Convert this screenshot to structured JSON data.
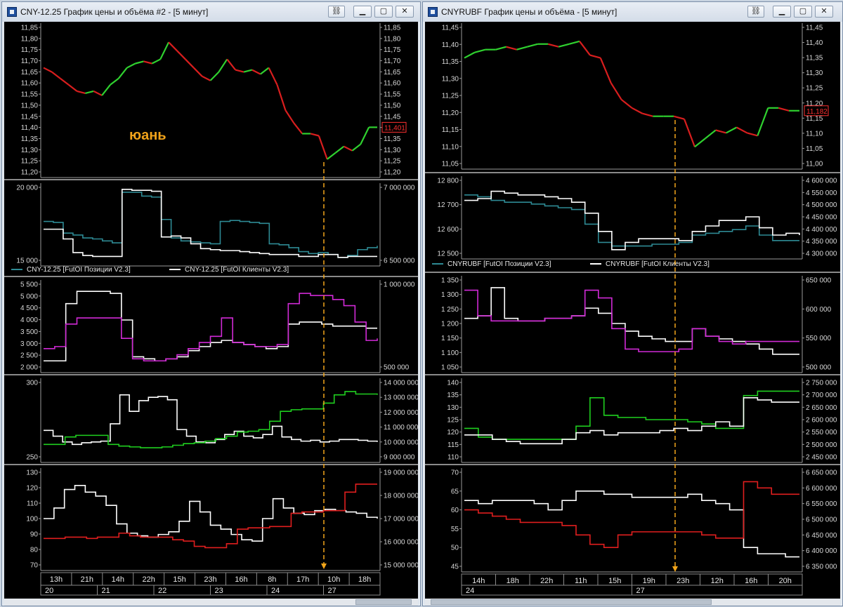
{
  "windows": [
    {
      "id": "left",
      "title": "CNY-12.25 График цены и объёма #2 - [5 минут]",
      "annotation": "юань",
      "last_price_label": "11,401",
      "legend": [
        "CNY-12.25 [FutOI Позиции V2.3]",
        "CNY-12.25 [FutOI Клиенты V2.3]"
      ],
      "time_ticks": [
        "13h",
        "21h",
        "14h",
        "22h",
        "15h",
        "23h",
        "16h",
        "8h",
        "17h",
        "10h",
        "18h"
      ],
      "date_ticks": [
        "20",
        "21",
        "22",
        "23",
        "24",
        "27"
      ]
    },
    {
      "id": "right",
      "title": "CNYRUBF График цены и объёма - [5 минут]",
      "last_price_label": "11,182",
      "legend": [
        "CNYRUBF [FutOI Позиции V2.3]",
        "CNYRUBF [FutOI Клиенты V2.3]"
      ],
      "time_ticks": [
        "14h",
        "18h",
        "22h",
        "11h",
        "15h",
        "19h",
        "23h",
        "12h",
        "16h",
        "20h"
      ],
      "date_ticks": [
        "24",
        "27"
      ]
    }
  ],
  "colors": {
    "bg": "#000000",
    "axis_text": "#d8d8d8",
    "candle_up": "#2fd12f",
    "candle_down": "#d81e1e",
    "teal": "#2e8a94",
    "white": "#ffffff",
    "magenta": "#d12ad6",
    "green": "#1fcf1f",
    "red": "#e01e1e",
    "marker": "#f2a51a",
    "annotation": "#f0a21a",
    "price_box": "#ff3030"
  },
  "chart_data": [
    {
      "window": "left",
      "panel": "price",
      "type": "line",
      "y_left_ticks": [
        "11,85",
        "11,80",
        "11,75",
        "11,70",
        "11,65",
        "11,60",
        "11,55",
        "11,50",
        "11,45",
        "11,40",
        "11,35",
        "11,30",
        "11,25",
        "11,20"
      ],
      "y_right_ticks": [
        "11,85",
        "11,80",
        "11,75",
        "11,70",
        "11,65",
        "11,60",
        "11,55",
        "11,50",
        "11,45",
        "11,40",
        "11,35",
        "11,30",
        "11,25",
        "11,20"
      ],
      "ylim": [
        11.19,
        11.87
      ],
      "series": [
        {
          "values": [
            11.68,
            11.66,
            11.63,
            11.6,
            11.57,
            11.56,
            11.57,
            11.55,
            11.6,
            11.63,
            11.68,
            11.7,
            11.71,
            11.7,
            11.72,
            11.8,
            11.76,
            11.72,
            11.68,
            11.64,
            11.62,
            11.66,
            11.72,
            11.67,
            11.66,
            11.67,
            11.65,
            11.68,
            11.6,
            11.48,
            11.42,
            11.37,
            11.37,
            11.36,
            11.25,
            11.28,
            11.31,
            11.29,
            11.32,
            11.4,
            11.4
          ]
        }
      ]
    },
    {
      "window": "left",
      "panel": "oi_positions",
      "type": "line",
      "y_left_ticks": [
        "20 000",
        "15 000"
      ],
      "y_right_ticks": [
        "7 000 000",
        "6 500 000"
      ],
      "ylim": [
        14000,
        21500
      ],
      "series": [
        {
          "color": "teal",
          "values": [
            18000,
            17900,
            16800,
            16600,
            16300,
            16200,
            16000,
            15800,
            21000,
            21000,
            20600,
            20500,
            18200,
            16300,
            16000,
            15900,
            15800,
            15700,
            18000,
            18100,
            18000,
            17900,
            17800,
            15700,
            15600,
            15300,
            14900,
            14700,
            14800,
            14600,
            14300,
            14500,
            15100,
            15300,
            15500
          ]
        },
        {
          "color": "white",
          "values": [
            17200,
            17200,
            16200,
            14800,
            14500,
            14400,
            14400,
            14400,
            21300,
            21200,
            21200,
            21100,
            16400,
            16500,
            16300,
            15700,
            15200,
            15100,
            15000,
            15000,
            14900,
            14800,
            14700,
            14600,
            14600,
            14600,
            14400,
            14400,
            14600,
            14600,
            14300,
            14400,
            14400,
            14400,
            14400
          ]
        }
      ]
    },
    {
      "window": "left",
      "panel": "clients",
      "type": "line",
      "y_left_ticks": [
        "5 500",
        "5 000",
        "4 500",
        "4 000",
        "3 500",
        "3 000",
        "2 500",
        "2 000"
      ],
      "y_right_ticks": [
        "1 000 000",
        "500 000"
      ],
      "ylim": [
        1700,
        5750
      ],
      "series": [
        {
          "color": "white",
          "values": [
            2000,
            2000,
            4800,
            5400,
            5400,
            5400,
            5300,
            4000,
            2200,
            2100,
            2000,
            2100,
            2200,
            2500,
            2700,
            2900,
            3000,
            2900,
            2800,
            2700,
            2600,
            2700,
            3800,
            3900,
            3900,
            3800,
            3700,
            3700,
            3700,
            3600,
            3600
          ]
        },
        {
          "color": "magenta",
          "values": [
            2600,
            2700,
            3800,
            4100,
            4100,
            4100,
            4100,
            3100,
            2100,
            2000,
            2000,
            2100,
            2300,
            2600,
            2900,
            3200,
            4100,
            2900,
            2800,
            2700,
            2700,
            2800,
            4800,
            5300,
            5200,
            5200,
            5000,
            4700,
            3900,
            3000,
            3100
          ]
        }
      ]
    },
    {
      "window": "left",
      "panel": "positions",
      "type": "line",
      "y_left_ticks": [
        "300",
        "250"
      ],
      "y_right_ticks": [
        "14 000 000",
        "13 000 000",
        "12 000 000",
        "11 000 000",
        "10 000 000",
        "9 000 000"
      ],
      "ylim": [
        225,
        315
      ],
      "series": [
        {
          "color": "white",
          "values": [
            257,
            250,
            243,
            240,
            242,
            243,
            244,
            265,
            300,
            280,
            293,
            297,
            298,
            294,
            258,
            250,
            243,
            242,
            246,
            252,
            256,
            250,
            248,
            252,
            262,
            249,
            246,
            244,
            245,
            243,
            244,
            246,
            246,
            245,
            244,
            243
          ]
        },
        {
          "color": "green",
          "values": [
            240,
            240,
            249,
            251,
            251,
            251,
            240,
            238,
            237,
            236,
            236,
            237,
            239,
            241,
            242,
            244,
            247,
            250,
            255,
            256,
            258,
            268,
            280,
            282,
            283,
            283,
            290,
            300,
            304,
            301,
            301,
            300
          ]
        }
      ]
    },
    {
      "window": "left",
      "panel": "volume",
      "type": "line",
      "y_left_ticks": [
        "130",
        "120",
        "110",
        "100",
        "90",
        "80",
        "70"
      ],
      "y_right_ticks": [
        "19 000 000",
        "18 000 000",
        "17 000 000",
        "16 000 000",
        "15 000 000"
      ],
      "ylim": [
        65,
        135
      ],
      "series": [
        {
          "color": "white",
          "values": [
            100,
            108,
            122,
            125,
            120,
            117,
            110,
            96,
            89,
            87,
            86,
            88,
            90,
            98,
            113,
            105,
            95,
            92,
            88,
            84,
            83,
            100,
            115,
            108,
            104,
            103,
            106,
            107,
            106,
            105,
            104,
            101,
            100
          ]
        },
        {
          "color": "red",
          "values": [
            85,
            85,
            86,
            86,
            85,
            86,
            86,
            89,
            87,
            86,
            86,
            86,
            84,
            83,
            79,
            78,
            78,
            81,
            92,
            93,
            93,
            94,
            94,
            104,
            105,
            105,
            106,
            106,
            120,
            126,
            126,
            126
          ]
        }
      ]
    },
    {
      "window": "right",
      "panel": "price",
      "type": "line",
      "y_left_ticks": [
        "11,45",
        "11,40",
        "11,35",
        "11,30",
        "11,25",
        "11,20",
        "11,15",
        "11,10",
        "11,05"
      ],
      "y_right_ticks": [
        "11,45",
        "11,40",
        "11,35",
        "11,30",
        "11,25",
        "11,20",
        "11,15",
        "11,10",
        "11,05",
        "11,00"
      ],
      "ylim": [
        10.99,
        11.48
      ],
      "series": [
        {
          "values": [
            11.37,
            11.39,
            11.4,
            11.4,
            11.41,
            11.4,
            11.41,
            11.42,
            11.42,
            11.41,
            11.42,
            11.43,
            11.38,
            11.37,
            11.28,
            11.22,
            11.19,
            11.17,
            11.16,
            11.16,
            11.16,
            11.15,
            11.05,
            11.08,
            11.11,
            11.1,
            11.12,
            11.1,
            11.09,
            11.19,
            11.19,
            11.18,
            11.18
          ]
        }
      ]
    },
    {
      "window": "right",
      "panel": "oi_positions",
      "type": "line",
      "y_left_ticks": [
        "12 800",
        "12 700",
        "12 600",
        "12 500"
      ],
      "y_right_ticks": [
        "4 600 000",
        "4 550 000",
        "4 500 000",
        "4 450 000",
        "4 400 000",
        "4 350 000",
        "4 300 000"
      ],
      "ylim": [
        12440,
        12840
      ],
      "series": [
        {
          "color": "teal",
          "values": [
            12760,
            12750,
            12730,
            12720,
            12720,
            12710,
            12700,
            12690,
            12680,
            12600,
            12500,
            12480,
            12480,
            12480,
            12490,
            12490,
            12500,
            12540,
            12550,
            12560,
            12570,
            12590,
            12540,
            12510,
            12510,
            12510
          ]
        },
        {
          "color": "white",
          "values": [
            12730,
            12740,
            12780,
            12770,
            12760,
            12760,
            12750,
            12740,
            12720,
            12660,
            12560,
            12460,
            12500,
            12520,
            12520,
            12520,
            12510,
            12560,
            12590,
            12620,
            12620,
            12640,
            12580,
            12540,
            12550,
            12540
          ]
        }
      ]
    },
    {
      "window": "right",
      "panel": "clients",
      "type": "line",
      "y_left_ticks": [
        "1 350",
        "1 300",
        "1 250",
        "1 200",
        "1 150",
        "1 100",
        "1 050"
      ],
      "y_right_ticks": [
        "650 000",
        "600 000",
        "550 000",
        "500 000"
      ],
      "ylim": [
        1030,
        1370
      ],
      "series": [
        {
          "color": "white",
          "values": [
            1220,
            1230,
            1340,
            1220,
            1210,
            1210,
            1220,
            1220,
            1230,
            1260,
            1240,
            1200,
            1170,
            1150,
            1140,
            1130,
            1130,
            1180,
            1150,
            1140,
            1130,
            1120,
            1100,
            1080,
            1080,
            1080
          ]
        },
        {
          "color": "magenta",
          "values": [
            1330,
            1230,
            1210,
            1210,
            1210,
            1210,
            1220,
            1220,
            1230,
            1330,
            1300,
            1180,
            1100,
            1090,
            1090,
            1090,
            1100,
            1180,
            1150,
            1130,
            1120,
            1130,
            1130,
            1130,
            1130,
            1130
          ]
        }
      ]
    },
    {
      "window": "right",
      "panel": "positions",
      "type": "line",
      "y_left_ticks": [
        "140",
        "135",
        "130",
        "125",
        "120",
        "115",
        "110"
      ],
      "y_right_ticks": [
        "2 750 000",
        "2 700 000",
        "2 650 000",
        "2 600 000",
        "2 550 000",
        "2 500 000",
        "2 450 000"
      ],
      "ylim": [
        108,
        142
      ],
      "series": [
        {
          "color": "green",
          "values": [
            121,
            117,
            116,
            116,
            116,
            116,
            116,
            116,
            122,
            135,
            127,
            126,
            126,
            125,
            125,
            125,
            124,
            123,
            121,
            121,
            136,
            138,
            138,
            138,
            138
          ]
        },
        {
          "color": "white",
          "values": [
            118,
            118,
            116,
            115,
            114,
            114,
            114,
            116,
            119,
            120,
            118,
            119,
            119,
            119,
            120,
            121,
            120,
            122,
            124,
            122,
            135,
            134,
            133,
            133,
            133
          ]
        }
      ]
    },
    {
      "window": "right",
      "panel": "volume",
      "type": "line",
      "y_left_ticks": [
        "70",
        "65",
        "60",
        "55",
        "50",
        "45"
      ],
      "y_right_ticks": [
        "6 650 000",
        "6 600 000",
        "6 550 000",
        "6 500 000",
        "6 450 000",
        "6 400 000",
        "6 350 000"
      ],
      "ylim": [
        42,
        72
      ],
      "series": [
        {
          "color": "white",
          "values": [
            63,
            62,
            63,
            63,
            63,
            62,
            60,
            63,
            66,
            66,
            65,
            65,
            64,
            64,
            64,
            64,
            65,
            63,
            62,
            60,
            48,
            46,
            46,
            45,
            45
          ]
        },
        {
          "color": "red",
          "values": [
            60,
            59,
            58,
            57,
            56,
            56,
            56,
            55,
            52,
            49,
            48,
            52,
            53,
            53,
            53,
            53,
            53,
            52,
            51,
            51,
            69,
            67,
            65,
            65,
            65
          ]
        }
      ]
    }
  ]
}
